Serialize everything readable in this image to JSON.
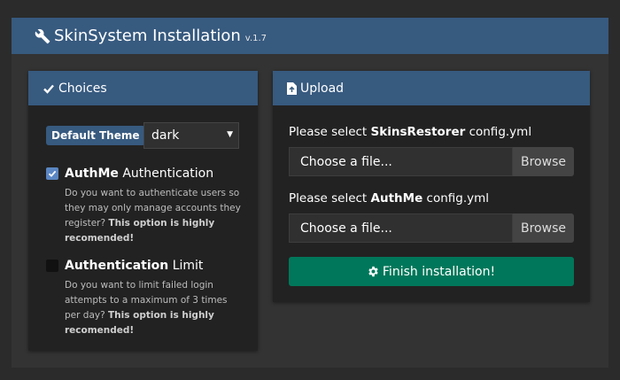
{
  "header": {
    "title": "SkinSystem Installation",
    "version": "v.1.7",
    "icon": "wrench-icon"
  },
  "choices": {
    "title": "Choices",
    "theme": {
      "badge": "Default Theme",
      "selected": "dark"
    },
    "authme": {
      "checked": true,
      "title_bold": "AuthMe",
      "title_rest": " Authentication",
      "desc": "Do you want to authenticate users so they may only manage accounts they register? ",
      "desc_bold": "This option is highly recomended!"
    },
    "limit": {
      "checked": false,
      "title_bold": "Authentication",
      "title_rest": " Limit",
      "desc": "Do you want to limit failed login attempts to a maximum of 3 times per day? ",
      "desc_bold": "This option is highly recomended!"
    }
  },
  "upload": {
    "title": "Upload",
    "skinsrestorer": {
      "prefix": "Please select ",
      "bold": "SkinsRestorer",
      "suffix": " config.yml",
      "placeholder": "Choose a file...",
      "browse": "Browse"
    },
    "authme": {
      "prefix": "Please select ",
      "bold": "AuthMe",
      "suffix": " config.yml",
      "placeholder": "Choose a file...",
      "browse": "Browse"
    },
    "finish": "Finish installation!"
  },
  "colors": {
    "header": "#375a7f",
    "success": "#00775a",
    "panel": "#222222",
    "background": "#2b2b2b"
  }
}
